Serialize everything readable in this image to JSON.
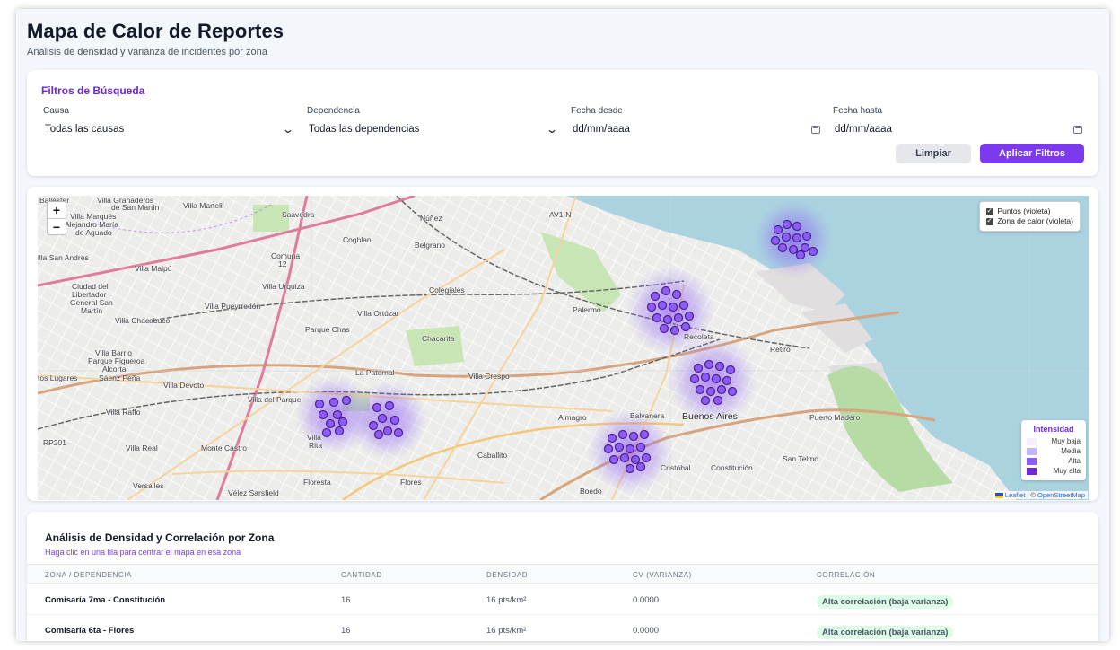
{
  "header": {
    "title": "Mapa de Calor de Reportes",
    "subtitle": "Análisis de densidad y varianza de incidentes por zona"
  },
  "filters": {
    "title": "Filtros de Búsqueda",
    "causa": {
      "label": "Causa",
      "value": "Todas las causas"
    },
    "dependencia": {
      "label": "Dependencia",
      "value": "Todas las dependencias"
    },
    "fecha_desde": {
      "label": "Fecha desde",
      "value": "dd/mm/aaaa"
    },
    "fecha_hasta": {
      "label": "Fecha hasta",
      "value": "dd/mm/aaaa"
    },
    "clear_label": "Limpiar",
    "apply_label": "Aplicar Filtros"
  },
  "map": {
    "zoom_in": "+",
    "zoom_out": "−",
    "layers": {
      "points": "Puntos (violeta)",
      "heat": "Zona de calor (violeta)"
    },
    "legend": {
      "title": "Intensidad",
      "items": [
        {
          "label": "Muy baja",
          "color": "#f3effd"
        },
        {
          "label": "Media",
          "color": "#c4b5fd"
        },
        {
          "label": "Alta",
          "color": "#8b5cf6"
        },
        {
          "label": "Muy alta",
          "color": "#6d28d9"
        }
      ]
    },
    "attribution": {
      "leaflet": "Leaflet",
      "sep": " | © ",
      "osm": "OpenStreetMap"
    },
    "places": {
      "ballester": "Ballester",
      "granaderos": "Villa Granaderos",
      "san_martin_top": "de San Martín",
      "martelli": "Villa Martelli",
      "saavedra": "Saavedra",
      "nunez": "Núñez",
      "marques": "Villa Marqués",
      "alejandro": "Alejandro María",
      "aguado": "de Aguado",
      "coghlan": "Coghlan",
      "belgrano": "Belgrano",
      "comuna": "Comuna",
      "comuna_n": "12",
      "san_andres": "illa San Andrés",
      "maipu": "Villa Maipú",
      "ciudad": "Ciudad del",
      "libertador": "Libertador",
      "general": "General San",
      "martin": "Martín",
      "urquiza": "Villa Urquiza",
      "colegiales": "Colegiales",
      "pueyrredon": "Villa Pueyrredón",
      "ortuzar": "Villa Ortúzar",
      "chacabuco": "Villa Chacabuco",
      "palermo": "Palermo",
      "parque_chas": "Parque Chas",
      "chacarita": "Chacarita",
      "recoleta": "Recoleta",
      "villa_barrio": "Villa Barrio",
      "figueroa": "Parque Figueroa",
      "alcorta": "Alcorta",
      "paternal": "La Paternal",
      "crespo": "Villa Crespo",
      "lugares": "tos Lugares",
      "saenz": "Sáenz Peña",
      "devoto": "Villa Devoto",
      "retiro": "Retiro",
      "parque": "Villa del Parque",
      "raffo": "Villa Raffo",
      "almagro": "Almagro",
      "balvanera": "Balvanera",
      "buenos_aires": "Buenos Aires",
      "madero": "Puerto Madero",
      "real": "Villa Real",
      "monte_castro": "Monte Castro",
      "villa_rita": "Villa",
      "rita": "Rita",
      "caballito": "Caballito",
      "san_telmo": "San Telmo",
      "cristobal": "Cristóbal",
      "constitucion": "Constitución",
      "versalles": "Versalles",
      "floresta": "Floresta",
      "flores": "Flores",
      "velez": "Vélez Sarsfield",
      "boedo": "Boedo",
      "rp201": "RP201",
      "av": "AV1-N"
    }
  },
  "analysis": {
    "title": "Análisis de Densidad y Correlación por Zona",
    "hint": "Haga clic en una fila para centrar el mapa en esa zona",
    "columns": [
      "ZONA / DEPENDENCIA",
      "CANTIDAD",
      "DENSIDAD",
      "CV (VARIANZA)",
      "CORRELACIÓN"
    ],
    "rows": [
      {
        "zona": "Comisaría 7ma - Constitución",
        "cantidad": "16",
        "densidad": "16 pts/km²",
        "cv": "0.0000",
        "correlacion": "Alta correlación (baja varianza)"
      },
      {
        "zona": "Comisaría 6ta - Flores",
        "cantidad": "16",
        "densidad": "16 pts/km²",
        "cv": "0.0000",
        "correlacion": "Alta correlación (baja varianza)"
      }
    ]
  }
}
